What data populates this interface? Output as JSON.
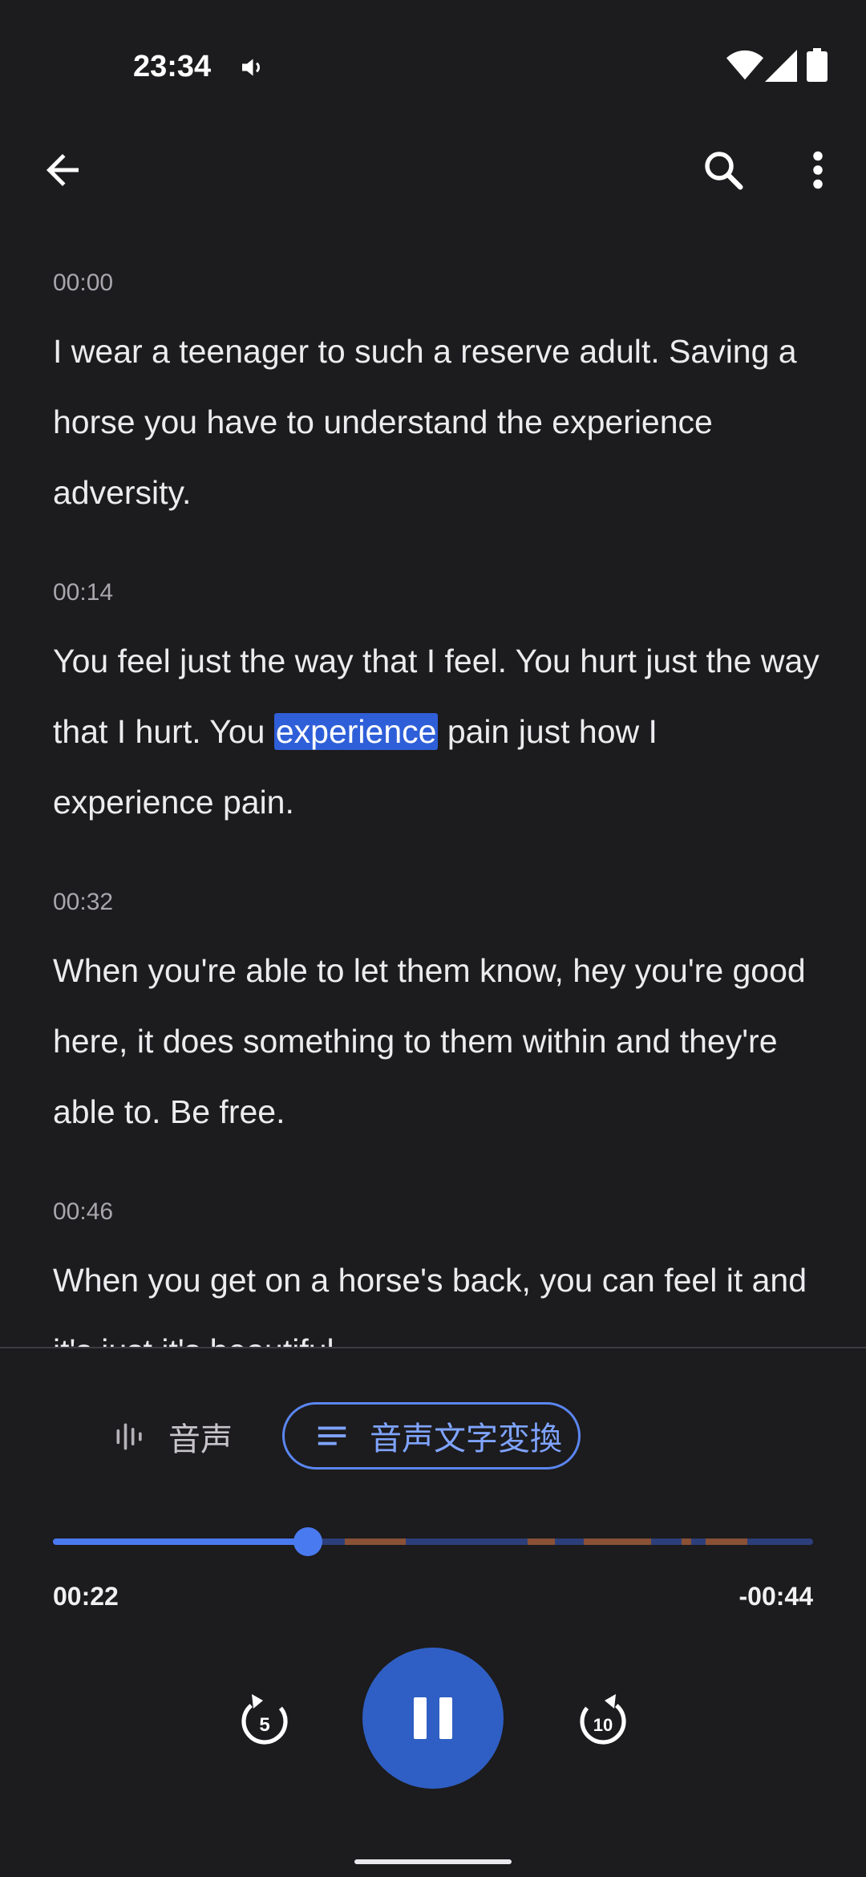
{
  "status_bar": {
    "time": "23:34",
    "icons": [
      "volume-icon",
      "wifi-icon",
      "signal-icon",
      "battery-icon"
    ]
  },
  "toolbar": {
    "icons": [
      "back-arrow-icon",
      "search-icon",
      "more-vert-icon"
    ]
  },
  "transcript": {
    "segments": [
      {
        "time": "00:00",
        "text": "I wear a teenager to such a reserve adult. Saving a horse you have to understand the experience adversity."
      },
      {
        "time": "00:14",
        "text_before": "You feel just the way that I feel. You hurt just the way that I hurt. You ",
        "highlight": "experience",
        "text_after": " pain just how I experience pain."
      },
      {
        "time": "00:32",
        "text": "When you're able to let them know, hey you're good here, it does something to them within and they're able to. Be free."
      },
      {
        "time": "00:46",
        "text": "When you get on a horse's back, you can feel it and it's just it's beautiful."
      }
    ]
  },
  "tabs": {
    "audio_label": "音声",
    "transcript_label": "音声文字変換",
    "selected": "transcript"
  },
  "player": {
    "elapsed": "00:22",
    "remaining": "-00:44",
    "progress_fraction": 0.335,
    "rewind_seconds": "5",
    "forward_seconds": "10",
    "state": "playing"
  },
  "colors": {
    "accent": "#4a7af0",
    "highlight": "#2f5fd8",
    "marker": "#8a5136",
    "background": "#1c1b1d"
  }
}
